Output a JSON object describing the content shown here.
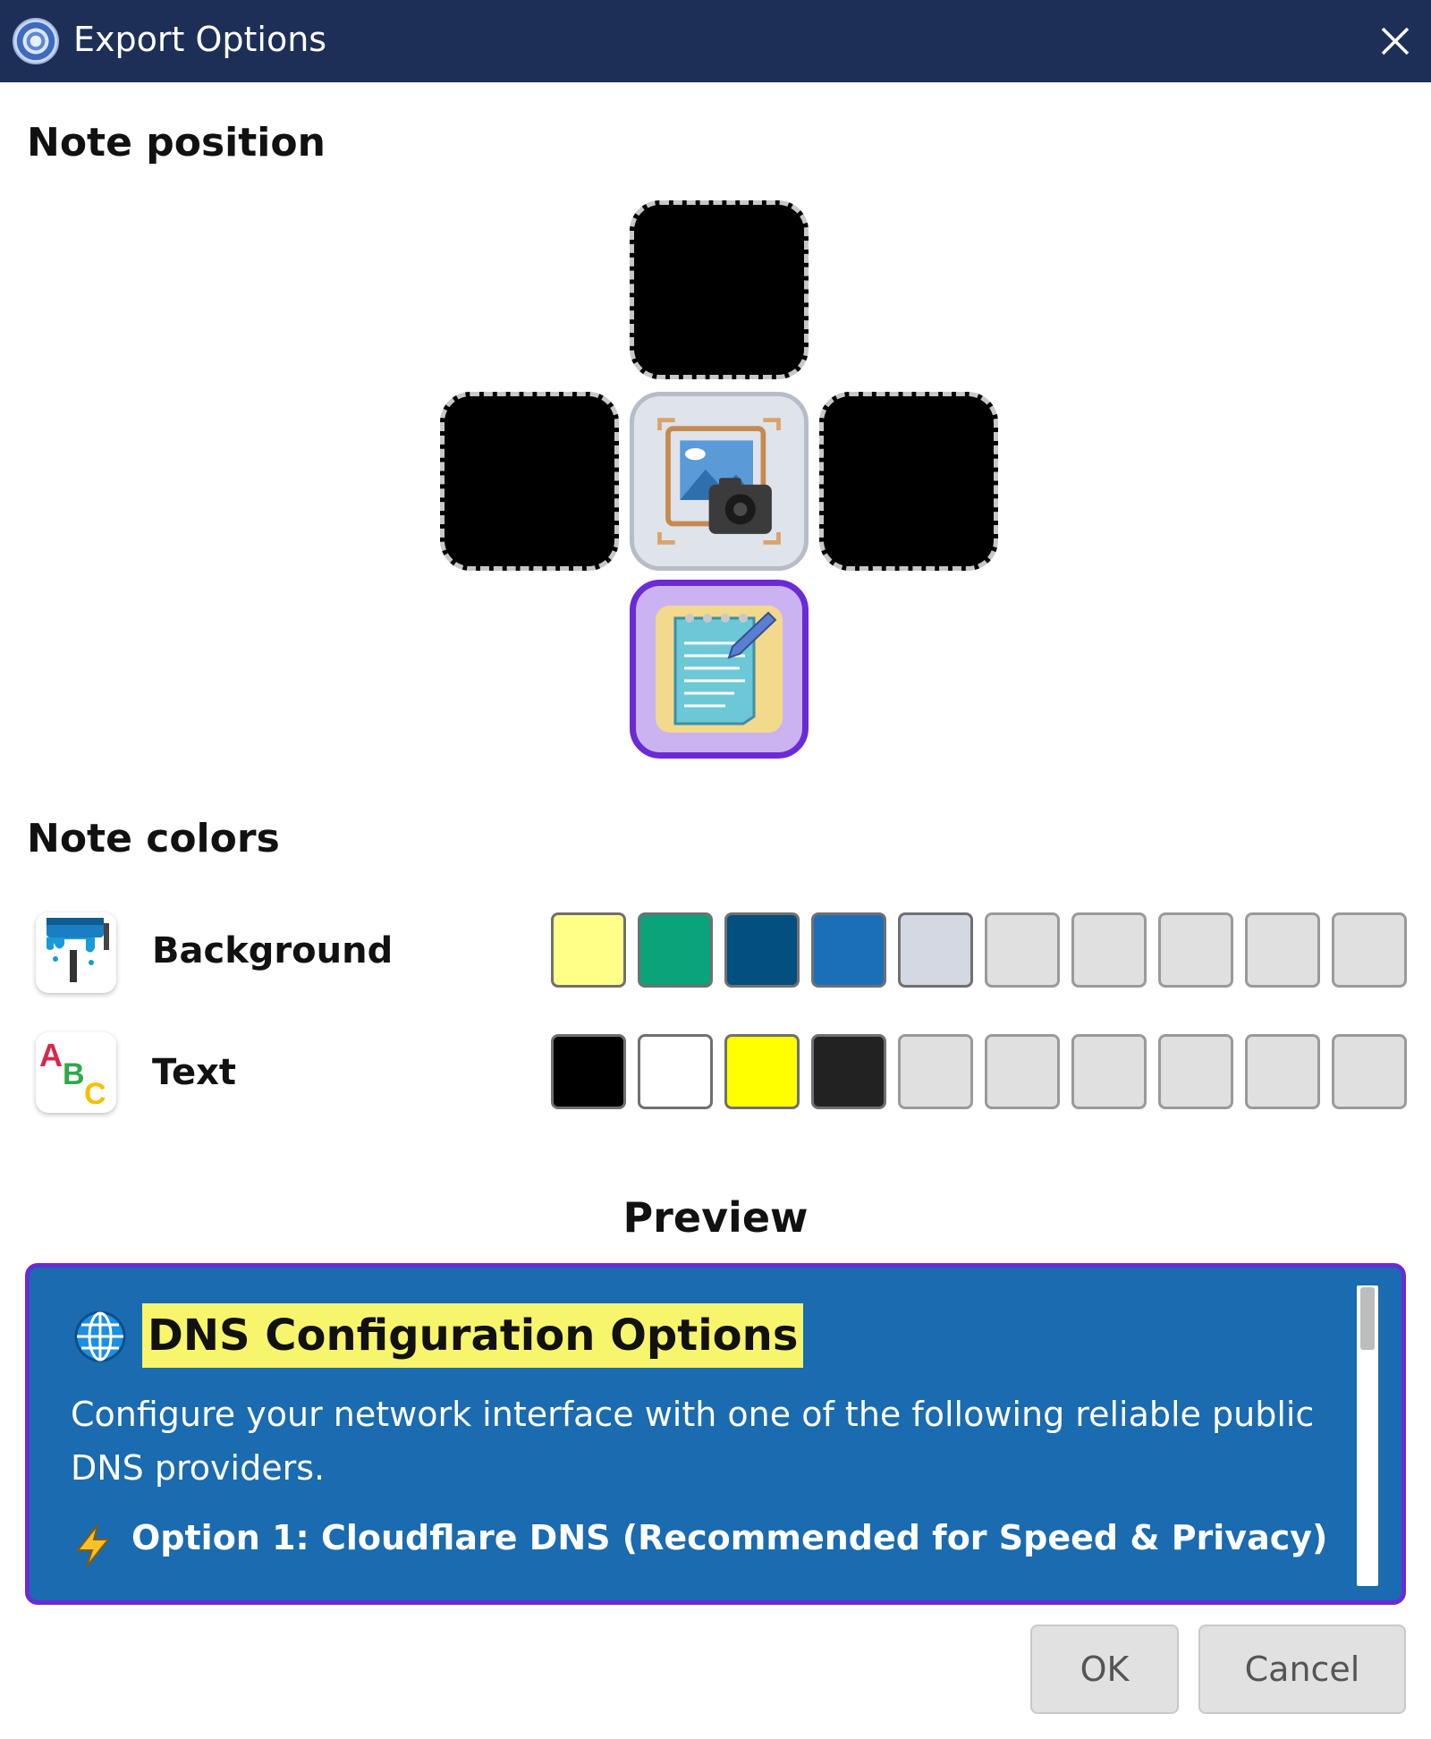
{
  "window": {
    "title": "Export Options"
  },
  "note_position": {
    "heading": "Note position",
    "slots": [
      "top",
      "left",
      "center",
      "right",
      "bottom"
    ],
    "selected": "bottom"
  },
  "note_colors": {
    "heading": "Note colors",
    "background": {
      "label": "Background",
      "swatches": [
        "#ffff88",
        "#0aa37a",
        "#024f80",
        "#1b6fb8",
        "#d4d8e2",
        "",
        "",
        "",
        "",
        ""
      ]
    },
    "text": {
      "label": "Text",
      "swatches": [
        "#000000",
        "#ffffff",
        "#ffff00",
        "#222222",
        "",
        "",
        "",
        "",
        "",
        ""
      ]
    }
  },
  "preview": {
    "heading": "Preview",
    "note_heading": "DNS Configuration Options",
    "note_body": "Configure your network interface with one of the following reliable public DNS providers.",
    "note_option": "Option 1: Cloudflare DNS (Recommended for Speed & Privacy)",
    "background_color": "#1a6bb0",
    "highlight_color": "#f7f56b"
  },
  "buttons": {
    "ok": "OK",
    "cancel": "Cancel"
  }
}
